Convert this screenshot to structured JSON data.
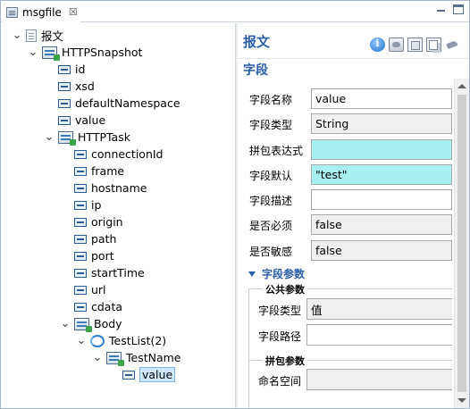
{
  "tab": {
    "label": "msgfile",
    "close": "☒"
  },
  "tree": {
    "nodes": [
      {
        "label": "报文",
        "depth": 0,
        "icon": "document-icon",
        "expanded": true
      },
      {
        "label": "HTTPSnapshot",
        "depth": 1,
        "icon": "struct-icon",
        "expanded": true
      },
      {
        "label": "id",
        "depth": 2,
        "icon": "field-icon"
      },
      {
        "label": "xsd",
        "depth": 2,
        "icon": "field-icon"
      },
      {
        "label": "defaultNamespace",
        "depth": 2,
        "icon": "field-icon"
      },
      {
        "label": "value",
        "depth": 2,
        "icon": "field-icon"
      },
      {
        "label": "HTTPTask",
        "depth": 2,
        "icon": "struct-icon",
        "expanded": true
      },
      {
        "label": "connectionId",
        "depth": 3,
        "icon": "field-icon"
      },
      {
        "label": "frame",
        "depth": 3,
        "icon": "field-icon"
      },
      {
        "label": "hostname",
        "depth": 3,
        "icon": "field-icon"
      },
      {
        "label": "ip",
        "depth": 3,
        "icon": "field-icon"
      },
      {
        "label": "origin",
        "depth": 3,
        "icon": "field-icon"
      },
      {
        "label": "path",
        "depth": 3,
        "icon": "field-icon"
      },
      {
        "label": "port",
        "depth": 3,
        "icon": "field-icon"
      },
      {
        "label": "startTime",
        "depth": 3,
        "icon": "field-icon"
      },
      {
        "label": "url",
        "depth": 3,
        "icon": "field-icon"
      },
      {
        "label": "cdata",
        "depth": 3,
        "icon": "field-icon"
      },
      {
        "label": "Body",
        "depth": 3,
        "icon": "struct-icon",
        "expanded": true
      },
      {
        "label": "TestList(2)",
        "depth": 4,
        "icon": "list-icon",
        "expanded": true
      },
      {
        "label": "TestName",
        "depth": 5,
        "icon": "struct-icon",
        "expanded": true
      },
      {
        "label": "value",
        "depth": 6,
        "icon": "field-icon",
        "selected": true
      }
    ]
  },
  "props": {
    "title": "报文",
    "section": "字段",
    "toolbar_icons": [
      "info-icon",
      "collapse-icon",
      "layout-icon",
      "copy-icon",
      "link-icon"
    ],
    "fields": [
      {
        "label": "字段名称",
        "value": "value",
        "style": "white"
      },
      {
        "label": "字段类型",
        "value": "String",
        "style": "grey"
      },
      {
        "label": "拼包表达式",
        "value": "",
        "style": "cyan"
      },
      {
        "label": "字段默认",
        "value": "\"test\"",
        "style": "cyan"
      },
      {
        "label": "字段描述",
        "value": "",
        "style": "white"
      },
      {
        "label": "是否必须",
        "value": "false",
        "style": "grey"
      },
      {
        "label": "是否敏感",
        "value": "false",
        "style": "grey"
      }
    ],
    "params_title": "字段参数",
    "public_group": {
      "title": "公共参数",
      "rows": [
        {
          "label": "字段类型",
          "value": "值",
          "style": "grey"
        },
        {
          "label": "字段路径",
          "value": "",
          "style": "white"
        }
      ]
    },
    "pack_group": {
      "title": "拼包参数",
      "rows": [
        {
          "label": "命名空间",
          "value": "",
          "style": "grey"
        }
      ]
    }
  }
}
